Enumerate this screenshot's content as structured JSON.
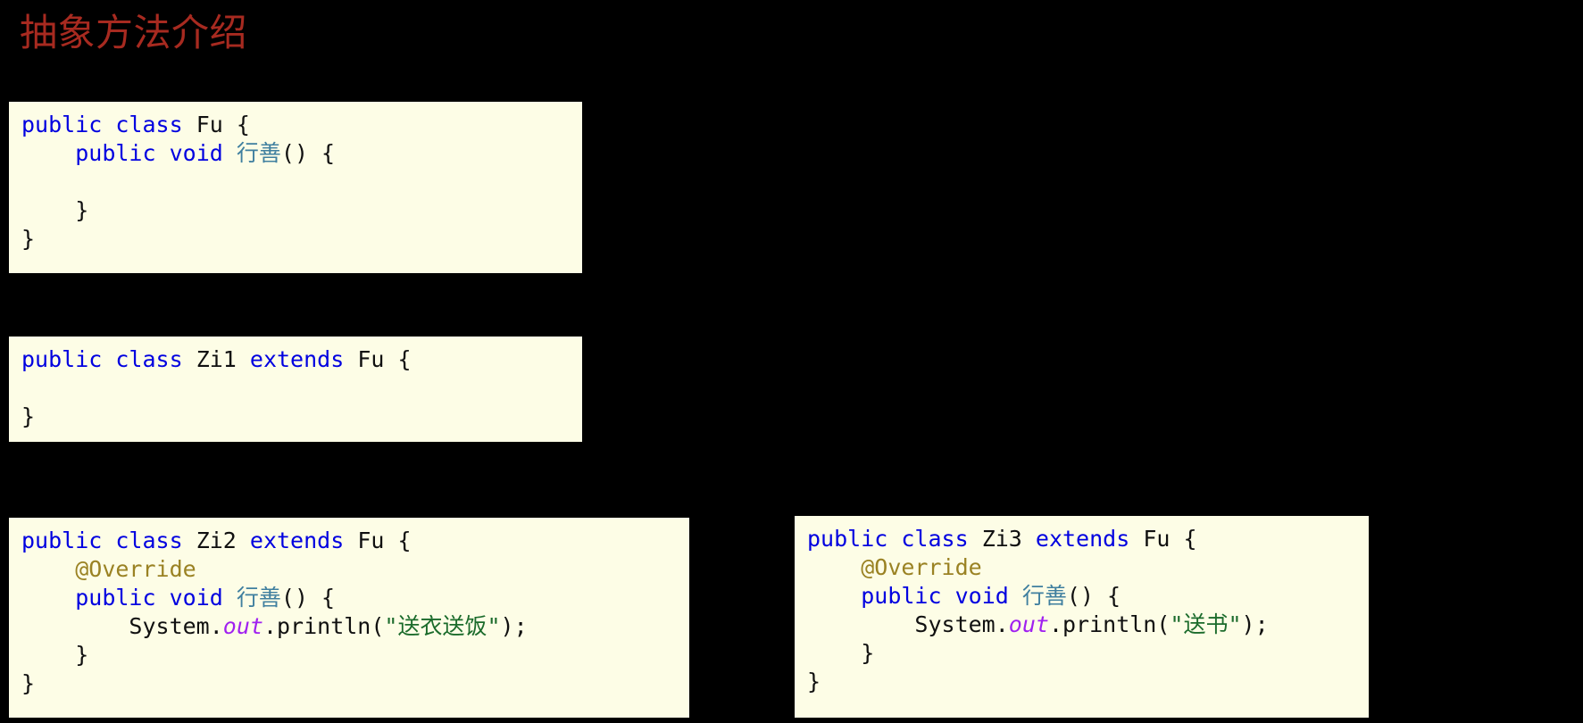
{
  "slide": {
    "title": "抽象方法介绍",
    "title_color": "#A72A20",
    "background_color": "#000000",
    "panel_background_color": "#FDFDE6"
  },
  "syntax_colors": {
    "keyword": "#0000E0",
    "plain": "#101010",
    "method_name": "#3F7F9F",
    "annotation": "#9A8223",
    "static_field": "#A020F0",
    "string_literal": "#1B6B2B"
  },
  "code_panels": [
    {
      "id": "fu",
      "class_name": "Fu",
      "lines": [
        [
          {
            "t": "public",
            "k": "kw"
          },
          {
            "t": " ",
            "k": "plain"
          },
          {
            "t": "class",
            "k": "kw"
          },
          {
            "t": " Fu {",
            "k": "plain"
          }
        ],
        [
          {
            "t": "    ",
            "k": "plain"
          },
          {
            "t": "public",
            "k": "kw"
          },
          {
            "t": " ",
            "k": "plain"
          },
          {
            "t": "void",
            "k": "kw"
          },
          {
            "t": " ",
            "k": "plain"
          },
          {
            "t": "行善",
            "k": "method"
          },
          {
            "t": "() {",
            "k": "plain"
          }
        ],
        [
          {
            "t": "",
            "k": "plain"
          }
        ],
        [
          {
            "t": "    }",
            "k": "plain"
          }
        ],
        [
          {
            "t": "}",
            "k": "plain"
          }
        ]
      ]
    },
    {
      "id": "zi1",
      "class_name": "Zi1",
      "lines": [
        [
          {
            "t": "public",
            "k": "kw"
          },
          {
            "t": " ",
            "k": "plain"
          },
          {
            "t": "class",
            "k": "kw"
          },
          {
            "t": " Zi1 ",
            "k": "plain"
          },
          {
            "t": "extends",
            "k": "kw"
          },
          {
            "t": " Fu {",
            "k": "plain"
          }
        ],
        [
          {
            "t": "",
            "k": "plain"
          }
        ],
        [
          {
            "t": "}",
            "k": "plain"
          }
        ]
      ]
    },
    {
      "id": "zi2",
      "class_name": "Zi2",
      "lines": [
        [
          {
            "t": "public",
            "k": "kw"
          },
          {
            "t": " ",
            "k": "plain"
          },
          {
            "t": "class",
            "k": "kw"
          },
          {
            "t": " Zi2 ",
            "k": "plain"
          },
          {
            "t": "extends",
            "k": "kw"
          },
          {
            "t": " Fu {",
            "k": "plain"
          }
        ],
        [
          {
            "t": "    ",
            "k": "plain"
          },
          {
            "t": "@Override",
            "k": "anno"
          }
        ],
        [
          {
            "t": "    ",
            "k": "plain"
          },
          {
            "t": "public",
            "k": "kw"
          },
          {
            "t": " ",
            "k": "plain"
          },
          {
            "t": "void",
            "k": "kw"
          },
          {
            "t": " ",
            "k": "plain"
          },
          {
            "t": "行善",
            "k": "method"
          },
          {
            "t": "() {",
            "k": "plain"
          }
        ],
        [
          {
            "t": "        System.",
            "k": "plain"
          },
          {
            "t": "out",
            "k": "field"
          },
          {
            "t": ".println(",
            "k": "plain"
          },
          {
            "t": "\"送衣送饭\"",
            "k": "str"
          },
          {
            "t": ");",
            "k": "plain"
          }
        ],
        [
          {
            "t": "    }",
            "k": "plain"
          }
        ],
        [
          {
            "t": "}",
            "k": "plain"
          }
        ]
      ]
    },
    {
      "id": "zi3",
      "class_name": "Zi3",
      "lines": [
        [
          {
            "t": "public",
            "k": "kw"
          },
          {
            "t": " ",
            "k": "plain"
          },
          {
            "t": "class",
            "k": "kw"
          },
          {
            "t": " Zi3 ",
            "k": "plain"
          },
          {
            "t": "extends",
            "k": "kw"
          },
          {
            "t": " Fu {",
            "k": "plain"
          }
        ],
        [
          {
            "t": "    ",
            "k": "plain"
          },
          {
            "t": "@Override",
            "k": "anno"
          }
        ],
        [
          {
            "t": "    ",
            "k": "plain"
          },
          {
            "t": "public",
            "k": "kw"
          },
          {
            "t": " ",
            "k": "plain"
          },
          {
            "t": "void",
            "k": "kw"
          },
          {
            "t": " ",
            "k": "plain"
          },
          {
            "t": "行善",
            "k": "method"
          },
          {
            "t": "() {",
            "k": "plain"
          }
        ],
        [
          {
            "t": "        System.",
            "k": "plain"
          },
          {
            "t": "out",
            "k": "field"
          },
          {
            "t": ".println(",
            "k": "plain"
          },
          {
            "t": "\"送书\"",
            "k": "str"
          },
          {
            "t": ");",
            "k": "plain"
          }
        ],
        [
          {
            "t": "    }",
            "k": "plain"
          }
        ],
        [
          {
            "t": "}",
            "k": "plain"
          }
        ]
      ]
    }
  ]
}
